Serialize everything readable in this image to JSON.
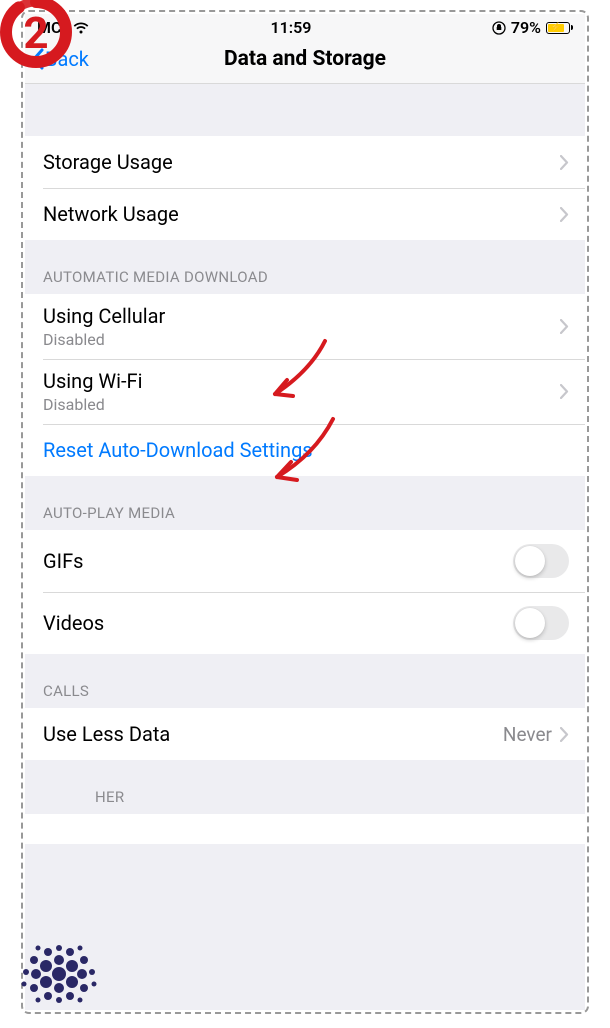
{
  "status": {
    "carrier": "MCI",
    "time": "11:59",
    "battery_percent": "79%"
  },
  "nav": {
    "back_label": "Back",
    "title": "Data and Storage"
  },
  "sections": {
    "usage": {
      "storage": "Storage Usage",
      "network": "Network Usage"
    },
    "auto_download": {
      "header": "AUTOMATIC MEDIA DOWNLOAD",
      "cellular": {
        "label": "Using Cellular",
        "sub": "Disabled"
      },
      "wifi": {
        "label": "Using Wi-Fi",
        "sub": "Disabled"
      },
      "reset": "Reset Auto-Download Settings"
    },
    "autoplay": {
      "header": "AUTO-PLAY MEDIA",
      "gifs": "GIFs",
      "videos": "Videos"
    },
    "calls": {
      "header": "CALLS",
      "use_less": {
        "label": "Use Less Data",
        "value": "Never"
      }
    },
    "other": {
      "header": "HER"
    }
  },
  "step_number": "2"
}
